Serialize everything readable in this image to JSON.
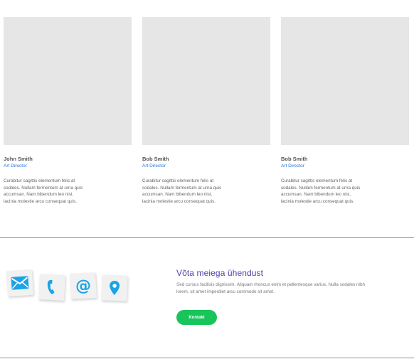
{
  "team": [
    {
      "name": "John Smith",
      "role": "Art Director",
      "bio": "Curabitur sagittis elementum felis at\nsodales. Nullam fermentum at urna quis\naccumsan. Nam bibendum leo nisi,\nlacinia molestie arcu consequat quis."
    },
    {
      "name": "Bob Smith",
      "role": "Art Director",
      "bio": "Curabitur sagittis elementum felis at\nsodales. Nullam fermentum at urna quis\naccumsan. Nam bibendum leo nisi,\nlacinia molestie arcu consequat quis."
    },
    {
      "name": "Bob Smith",
      "role": "Art Director",
      "bio": "Curabitur sagittis elementum felis at\nsodales. Nullam fermentum at urna quis\naccumsan. Nam bibendum leo nisi,\nlacinia molestie arcu consequat quis."
    }
  ],
  "contact": {
    "title": "Võta meiega ühendust",
    "text": "Sed cursus facilisis dignissim. Aliquam rhoncus enim et pellentesque varius. Nulla sodales nibh\nlorem, sit amet imperdiet arcu commodo sit amet.",
    "button_label": "Kontakt",
    "icons": [
      "envelope-icon",
      "phone-icon",
      "at-sign-icon",
      "location-pin-icon"
    ]
  },
  "colors": {
    "accent_blue": "#2a74d6",
    "title_purple": "#4a3fb0",
    "button_green": "#18c55a",
    "icon_blue": "#1aa3e6",
    "placeholder_gray": "#e6e6e6"
  }
}
